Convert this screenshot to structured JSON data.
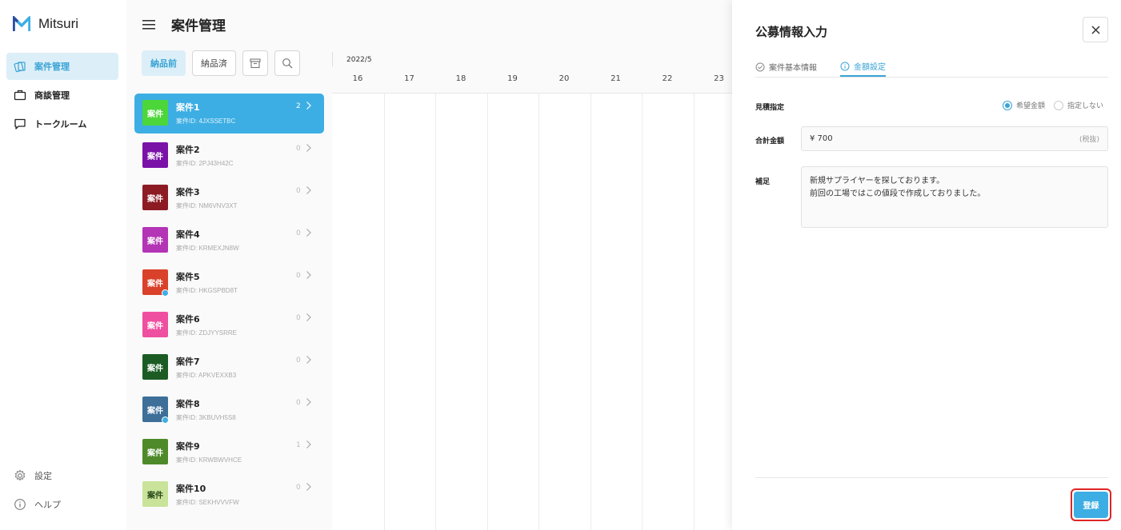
{
  "app": {
    "name": "Mitsuri"
  },
  "sidebar": {
    "items": [
      {
        "label": "案件管理",
        "icon": "folders-icon"
      },
      {
        "label": "商談管理",
        "icon": "briefcase-icon"
      },
      {
        "label": "トークルーム",
        "icon": "chat-icon"
      }
    ],
    "bottom_items": [
      {
        "label": "設定",
        "icon": "gear-icon"
      },
      {
        "label": "ヘルプ",
        "icon": "info-icon"
      }
    ]
  },
  "header": {
    "title": "案件管理"
  },
  "filters": {
    "before_delivery": "納品前",
    "delivered": "納品済"
  },
  "cases": [
    {
      "badge": "案件",
      "name": "案件1",
      "id": "案件ID: 4JXSSETBC",
      "count": "2",
      "color": "#4cd63a"
    },
    {
      "badge": "案件",
      "name": "案件2",
      "id": "案件ID: 2PJ43H42C",
      "count": "0",
      "color": "#7a12a8"
    },
    {
      "badge": "案件",
      "name": "案件3",
      "id": "案件ID: NM6VNV3XT",
      "count": "0",
      "color": "#8c1b24"
    },
    {
      "badge": "案件",
      "name": "案件4",
      "id": "案件ID: KRMEXJN8W",
      "count": "0",
      "color": "#b334b5"
    },
    {
      "badge": "案件",
      "name": "案件5",
      "id": "案件ID: HKGSPBD8T",
      "count": "0",
      "color": "#d9412a"
    },
    {
      "badge": "案件",
      "name": "案件6",
      "id": "案件ID: ZDJYYSRRE",
      "count": "0",
      "color": "#ef4fa0"
    },
    {
      "badge": "案件",
      "name": "案件7",
      "id": "案件ID: APKVEXXB3",
      "count": "0",
      "color": "#1c5c24"
    },
    {
      "badge": "案件",
      "name": "案件8",
      "id": "案件ID: 3KBUVH5S8",
      "count": "0",
      "color": "#3d6f99"
    },
    {
      "badge": "案件",
      "name": "案件9",
      "id": "案件ID: KRWBWVHCE",
      "count": "1",
      "color": "#4f8a2a"
    },
    {
      "badge": "案件",
      "name": "案件10",
      "id": "案件ID: SEKHVVVFW",
      "count": "0",
      "color": "#c9e39a"
    }
  ],
  "calendar": {
    "month": "2022/5",
    "days": [
      "16",
      "17",
      "18",
      "19",
      "20",
      "21",
      "22",
      "23"
    ]
  },
  "panel": {
    "title": "公募情報入力",
    "tabs": [
      {
        "label": "案件基本情報",
        "icon": "check-circle-icon"
      },
      {
        "label": "金額設定",
        "icon": "info-circle-icon"
      }
    ],
    "estimate": {
      "label": "見積指定",
      "options": [
        "希望金額",
        "指定しない"
      ],
      "selected": "希望金額"
    },
    "total": {
      "label": "合計金額",
      "value": "¥ 700",
      "suffix": "(税抜)"
    },
    "note": {
      "label": "補足",
      "value": "新規サプライヤーを探しております。\n前回の工場ではこの値段で作成しておりました。"
    },
    "submit_label": "登録"
  },
  "colors": {
    "accent": "#3daee3",
    "highlight": "#e02525"
  }
}
